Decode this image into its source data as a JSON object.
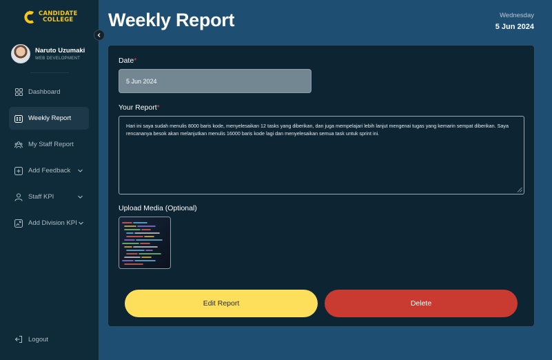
{
  "brand": {
    "line1": "CANDIDATE",
    "line2": "COLLEGE",
    "color": "#f6c71c",
    "icon": "candidate-college-logo"
  },
  "user": {
    "name": "Naruto Uzumaki",
    "role": "WEB DEVELOPMENT"
  },
  "sidebar": {
    "items": [
      {
        "label": "Dashboard",
        "icon": "grid-icon"
      },
      {
        "label": "Weekly Report",
        "icon": "calendar-icon",
        "active": true
      },
      {
        "label": "My Staff Report",
        "icon": "team-icon"
      },
      {
        "label": "Add Feedback",
        "icon": "plus-square-icon",
        "has_dropdown": true
      },
      {
        "label": "Staff KPI",
        "icon": "user-icon",
        "has_dropdown": true
      },
      {
        "label": "Add Division KPI",
        "icon": "image-add-icon",
        "has_dropdown": true
      }
    ],
    "logout_label": "Logout"
  },
  "header": {
    "title": "Weekly Report",
    "day": "Wednesday",
    "date": "5 Jun 2024"
  },
  "form": {
    "date_label": "Date",
    "required_mark": "*",
    "date_value": "5 Jun 2024",
    "report_label": "Your Report",
    "report_value": "Hari ini saya sudah menulis 8000 baris kode, menyelesaikan 12 tasks yang diberikan, dan juga mempelajari lebih lanjut mengenai tugas yang kemarin sempat diberikan. Saya rencananya besok akan melanjutkan menulis 16000 baris kode lagi dan menyelesaikan semua task untuk sprint ini.",
    "media_label": "Upload Media (Optional)",
    "media_thumbnail": "code-screenshot-thumbnail"
  },
  "actions": {
    "edit_label": "Edit Report",
    "delete_label": "Delete"
  },
  "colors": {
    "background": "#1e4f73",
    "sidebar": "#0f2a38",
    "card": "#0d2533",
    "edit_button": "#fedf5b",
    "delete_button": "#c93a30",
    "required": "#e5484d"
  }
}
